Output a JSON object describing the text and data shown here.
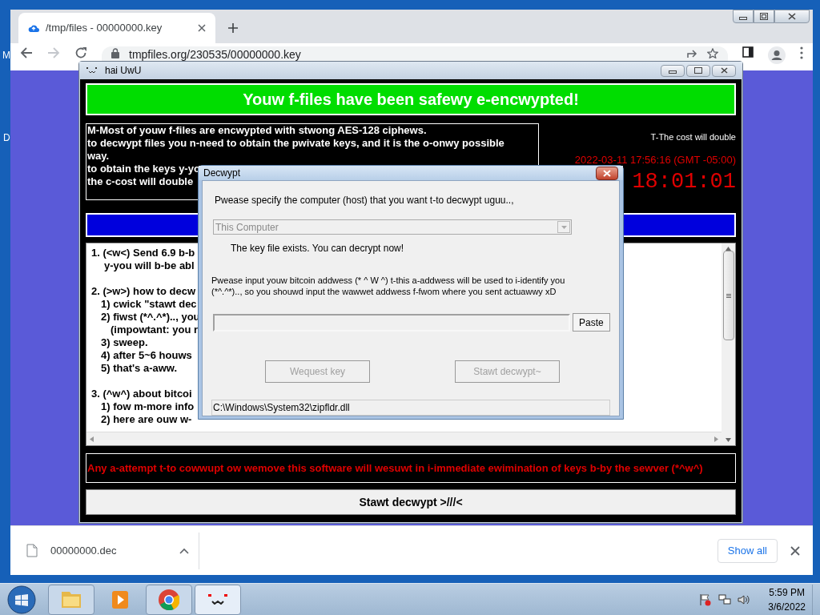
{
  "desktop": {
    "labels": [
      "M",
      "D"
    ]
  },
  "browser": {
    "tab": {
      "title": "/tmp/files - 00000000.key"
    },
    "address": "tmpfiles.org/230535/00000000.key",
    "forward_disabled": true,
    "downloads": [
      {
        "filename": "00000000.dec"
      }
    ],
    "show_all": "Show all"
  },
  "ransom_window": {
    "title": "hai UwU",
    "banner": "Youw f-files have been safewy e-encwypted!",
    "intro_lines": [
      "M-Most of youw f-files are encwypted with stwong AES-128 ciphews.",
      "to decwypt files you n-need to obtain the pwivate keys, and it is the o-onwy possible way.",
      "to obtain the keys y-yo",
      "the c-cost will double"
    ],
    "cost_note": "T-The cost will double",
    "deadline": "2022-03-11 17:56:16 (GMT -05:00)",
    "countdown": "18:01:01",
    "instructions": [
      {
        "kind": "heading",
        "text": "1. (<w<) Send 6.9 b-b"
      },
      {
        "kind": "wrap",
        "text": "y-you will b-be abl"
      },
      {
        "kind": "blank"
      },
      {
        "kind": "heading",
        "text": "2. (>w>) how to decw"
      },
      {
        "kind": "step",
        "text": "1) cwick \"stawt dec"
      },
      {
        "kind": "step",
        "text": "2) fiwst (*^.^*).., you"
      },
      {
        "kind": "note",
        "text": "(impowtant: you r"
      },
      {
        "kind": "step",
        "text": "3) sweep."
      },
      {
        "kind": "step",
        "text": "4) after 5~6 houws"
      },
      {
        "kind": "step",
        "text": "5) that's a-aww."
      },
      {
        "kind": "blank"
      },
      {
        "kind": "heading",
        "text": "3. (^w^) about bitcoi"
      },
      {
        "kind": "step",
        "text": "1) fow m-more info"
      },
      {
        "kind": "step",
        "text": "2) here are ouw w-"
      }
    ],
    "warning": "Any a-attempt t-to cowwupt ow wemove this software will wesuwt in i-immediate ewimination of keys b-by the sewver (*^w^)",
    "decrypt_button": "Stawt decwypt >///<"
  },
  "dialog": {
    "title": "Decwypt",
    "host_prompt": "Pwease specify the computer (host) that you want t-to decwypt uguu..,",
    "host_select": {
      "value": "This Computer",
      "disabled": true
    },
    "key_status": "The key file exists. You can decrypt now!",
    "address_prompt": "Pwease input youw bitcoin addwess (* ^ W ^) t-this a-addwess will be used to i-identify you (*^.^*).., so you shouwd input the wawwet addwess f-fwom where you sent actuawwy xD",
    "paste": "Paste",
    "buttons": [
      {
        "label": "Wequest key",
        "disabled": true
      },
      {
        "label": "Stawt decwypt~",
        "disabled": true
      }
    ],
    "path": "C:\\Windows\\System32\\zipfldr.dll"
  },
  "taskbar": {
    "apps": [
      {
        "kind": "folder",
        "open": true,
        "focused": false
      },
      {
        "kind": "player",
        "open": false,
        "focused": false
      },
      {
        "kind": "browser",
        "open": true,
        "focused": false
      },
      {
        "kind": "face",
        "open": true,
        "focused": true
      }
    ],
    "clock": {
      "time": "5:59 PM",
      "date": "3/6/2022"
    }
  }
}
